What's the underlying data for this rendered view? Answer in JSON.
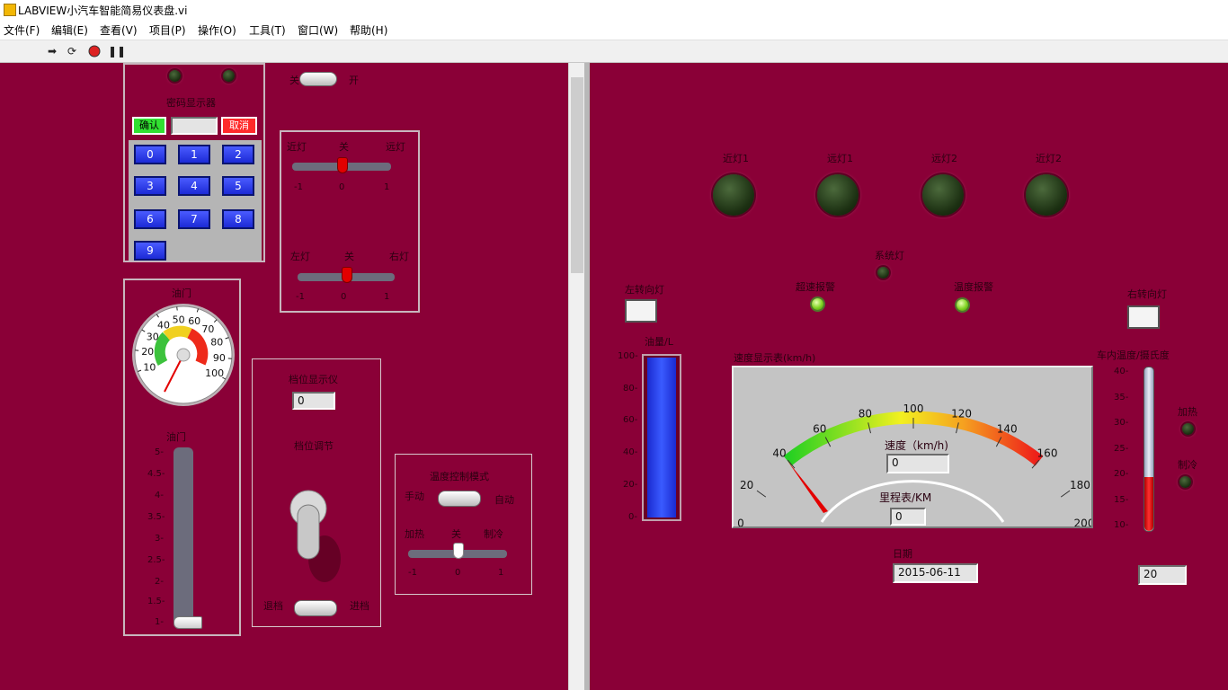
{
  "window": {
    "title": "LABVIEW小汽车智能简易仪表盘.vi"
  },
  "menu": [
    "文件(F)",
    "编辑(E)",
    "查看(V)",
    "项目(P)",
    "操作(O)",
    "工具(T)",
    "窗口(W)",
    "帮助(H)"
  ],
  "toolbar": {
    "icons": [
      "run-arrow-icon",
      "run-continuous-icon",
      "abort-icon",
      "pause-icon"
    ]
  },
  "left_panel": {
    "top_toggle": {
      "off": "关",
      "on": "开"
    },
    "password": {
      "title": "密码显示器",
      "confirm": "确认",
      "cancel": "取消",
      "display": "",
      "keys": [
        "0",
        "1",
        "2",
        "3",
        "4",
        "5",
        "6",
        "7",
        "8",
        "9"
      ]
    },
    "light_switch": {
      "labels": [
        "近灯",
        "关",
        "远灯"
      ],
      "ticks": [
        "-1",
        "0",
        "1"
      ],
      "value": 0
    },
    "turn_switch": {
      "labels": [
        "左灯",
        "关",
        "右灯"
      ],
      "ticks": [
        "-1",
        "0",
        "1"
      ],
      "value": 0
    },
    "throttle_gauge": {
      "title": "油门",
      "ticks": [
        "10",
        "20",
        "30",
        "40",
        "50",
        "60",
        "70",
        "80",
        "90",
        "100"
      ],
      "value": 10
    },
    "throttle_slider": {
      "title": "油门",
      "ticks": [
        "5-",
        "4.5-",
        "4-",
        "3.5-",
        "3-",
        "2.5-",
        "2-",
        "1.5-",
        "1-"
      ],
      "value": 1
    },
    "gear": {
      "display_title": "档位显示仪",
      "display_value": "0",
      "adjust_title": "档位调节",
      "left": "退档",
      "right": "进档"
    },
    "temp_control": {
      "title": "温度控制模式",
      "manual": "手动",
      "auto": "自动",
      "labels": [
        "加热",
        "关",
        "制冷"
      ],
      "ticks": [
        "-1",
        "0",
        "1"
      ],
      "value": 0
    }
  },
  "right_panel": {
    "lamps": [
      "近灯1",
      "远灯1",
      "远灯2",
      "近灯2"
    ],
    "system_lamp": "系统灯",
    "overspeed_alarm": "超速报警",
    "temp_alarm": "温度报警",
    "left_turn": "左转向灯",
    "right_turn": "右转向灯",
    "fuel": {
      "title": "油量/L",
      "ticks": [
        "100-",
        "80-",
        "60-",
        "40-",
        "20-",
        "0-"
      ],
      "value": 100
    },
    "speedometer": {
      "title": "速度显示表(km/h)",
      "ticks": [
        "0",
        "20",
        "40",
        "60",
        "80",
        "100",
        "120",
        "140",
        "160",
        "180",
        "200"
      ],
      "speed_label": "速度（km/h)",
      "speed_value": "0",
      "odometer_label": "里程表/KM",
      "odometer_value": "0"
    },
    "date": {
      "label": "日期",
      "value": "2015-06-11"
    },
    "thermometer": {
      "title": "车内温度/摄氏度",
      "ticks": [
        "40-",
        "35-",
        "30-",
        "25-",
        "20-",
        "15-",
        "10-"
      ],
      "value": 20,
      "display": "20"
    },
    "heat": "加热",
    "cool": "制冷"
  },
  "colors": {
    "panel": "#8a0037",
    "accent_green": "#7ed321",
    "accent_blue": "#1c2ad6",
    "needle": "#e30000"
  }
}
